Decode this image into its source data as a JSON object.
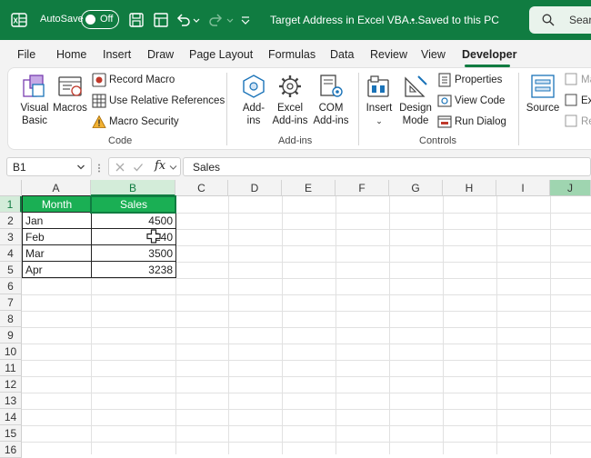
{
  "titlebar": {
    "autosave_label": "AutoSave",
    "autosave_state": "Off",
    "document_title": "Target Address in Excel VBA...",
    "save_status": "• Saved to this PC",
    "search_label": "Sear",
    "accent_color": "#107c41"
  },
  "menu": {
    "tabs": [
      "File",
      "Home",
      "Insert",
      "Draw",
      "Page Layout",
      "Formulas",
      "Data",
      "Review",
      "View",
      "Developer"
    ],
    "active": "Developer"
  },
  "ribbon": {
    "code": {
      "visual_basic": [
        "Visual",
        "Basic"
      ],
      "macros": "Macros",
      "record_macro": "Record Macro",
      "use_relative": "Use Relative References",
      "macro_security": "Macro Security",
      "group_label": "Code"
    },
    "addins": {
      "addins": [
        "Add-",
        "ins"
      ],
      "excel_addins": [
        "Excel",
        "Add-ins"
      ],
      "com_addins": [
        "COM",
        "Add-ins"
      ],
      "group_label": "Add-ins"
    },
    "controls": {
      "insert": "Insert",
      "design_mode": [
        "Design",
        "Mode"
      ],
      "properties": "Properties",
      "view_code": "View Code",
      "run_dialog": "Run Dialog",
      "group_label": "Controls"
    },
    "xml": {
      "source": "Source",
      "partial": [
        "Ma",
        "Ex",
        "Re"
      ]
    }
  },
  "formula_bar": {
    "name_box": "B1",
    "fx_label": "fx",
    "formula": "Sales"
  },
  "grid": {
    "columns": [
      "A",
      "B",
      "C",
      "D",
      "E",
      "F",
      "G",
      "H",
      "I",
      "J"
    ],
    "rows": [
      "1",
      "2",
      "3",
      "4",
      "5",
      "6",
      "7",
      "8",
      "9",
      "10",
      "11",
      "12",
      "13",
      "14",
      "15",
      "16"
    ],
    "table_header": [
      "Month",
      "Sales"
    ],
    "table_rows": [
      [
        "Jan",
        "4500"
      ],
      [
        "Feb",
        "240"
      ],
      [
        "Mar",
        "3500"
      ],
      [
        "Apr",
        "3238"
      ]
    ]
  }
}
